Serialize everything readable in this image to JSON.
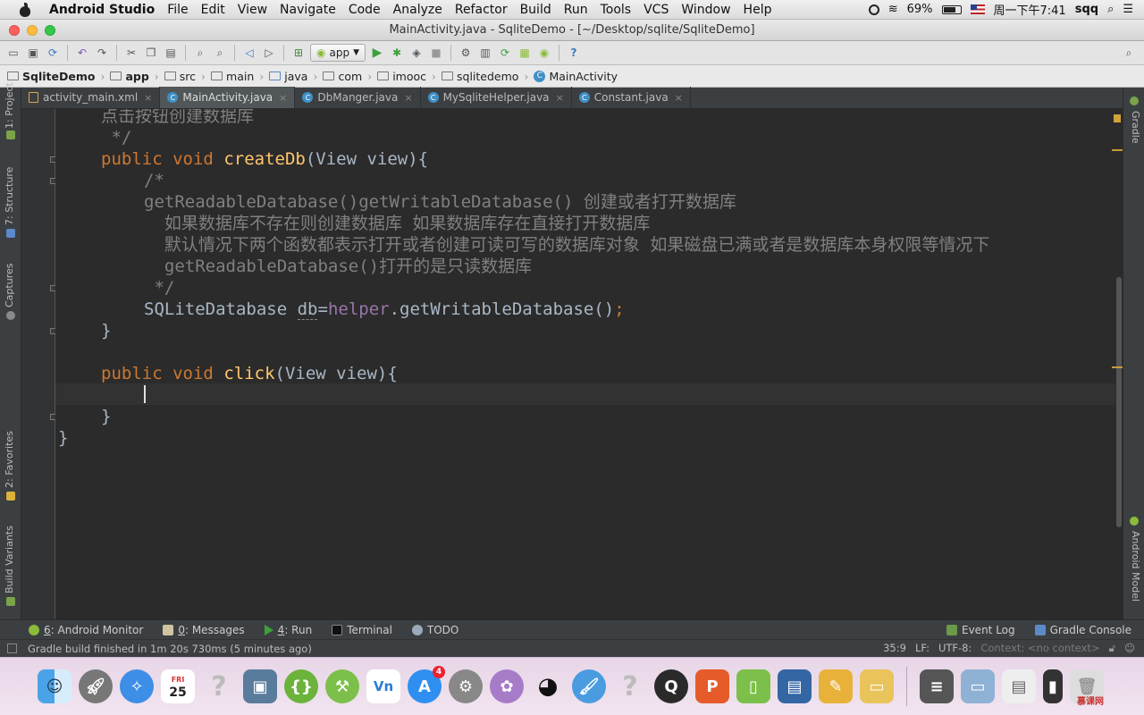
{
  "menubar": {
    "app_name": "Android Studio",
    "items": [
      "File",
      "Edit",
      "View",
      "Navigate",
      "Code",
      "Analyze",
      "Refactor",
      "Build",
      "Run",
      "Tools",
      "VCS",
      "Window",
      "Help"
    ],
    "battery": "69%",
    "clock": "周一下午7:41",
    "user": "sqq"
  },
  "window": {
    "title": "MainActivity.java - SqliteDemo - [~/Desktop/sqlite/SqliteDemo]"
  },
  "toolbar": {
    "run_config": "app"
  },
  "breadcrumbs": [
    "SqliteDemo",
    "app",
    "src",
    "main",
    "java",
    "com",
    "imooc",
    "sqlitedemo",
    "MainActivity"
  ],
  "tabs": [
    {
      "label": "activity_main.xml",
      "type": "xml"
    },
    {
      "label": "MainActivity.java",
      "type": "class",
      "active": true
    },
    {
      "label": "DbManger.java",
      "type": "class"
    },
    {
      "label": "MySqliteHelper.java",
      "type": "class"
    },
    {
      "label": "Constant.java",
      "type": "class"
    }
  ],
  "left_tools": [
    "1: Project",
    "7: Structure",
    "Captures",
    "2: Favorites",
    "Build Variants"
  ],
  "right_tools": [
    "Gradle",
    "Android Model"
  ],
  "code": {
    "l0": "点击按钮创建数据库",
    "l1": " */",
    "l2_kw1": "public",
    "l2_kw2": "void",
    "l2_fn": "createDb",
    "l2_rest": "(View view){",
    "l3": "/*",
    "l4": "getReadableDatabase()getWritableDatabase() 创建或者打开数据库",
    "l5": "  如果数据库不存在则创建数据库 如果数据库存在直接打开数据库",
    "l6": "  默认情况下两个函数都表示打开或者创建可读可写的数据库对象 如果磁盘已满或者是数据库本身权限等情况下",
    "l7": "  getReadableDatabase()打开的是只读数据库",
    "l8": " */",
    "l9_type": "SQLiteDatabase ",
    "l9_var": "db",
    "l9_eq": "=",
    "l9_field": "helper",
    "l9_call": ".getWritableDatabase()",
    "l9_semi": ";",
    "l10": "}",
    "l12_kw1": "public",
    "l12_kw2": "void",
    "l12_fn": "click",
    "l12_rest": "(View view){",
    "l14": "}",
    "l15": "}"
  },
  "bottom_tools": [
    {
      "key": "6",
      "label": ": Android Monitor"
    },
    {
      "key": "0",
      "label": ": Messages"
    },
    {
      "key": "4",
      "label": ": Run"
    },
    {
      "key": "",
      "label": "Terminal"
    },
    {
      "key": "",
      "label": "TODO"
    }
  ],
  "bottom_right_tools": [
    "Event Log",
    "Gradle Console"
  ],
  "status": {
    "message": "Gradle build finished in 1m 20s 730ms (5 minutes ago)",
    "position": "35:9",
    "line_sep": "LF:",
    "encoding": "UTF-8:",
    "context": "Context: <no context>"
  },
  "dock": {
    "calendar_month": "FRI",
    "calendar_day": "25",
    "appstore_badge": "4",
    "watermark": "慕课网"
  },
  "colors": {
    "keyword": "#cc7832",
    "function": "#ffc66d",
    "comment": "#808080",
    "field": "#9876aa",
    "text": "#a9b7c6",
    "editor_bg": "#2b2b2b"
  }
}
